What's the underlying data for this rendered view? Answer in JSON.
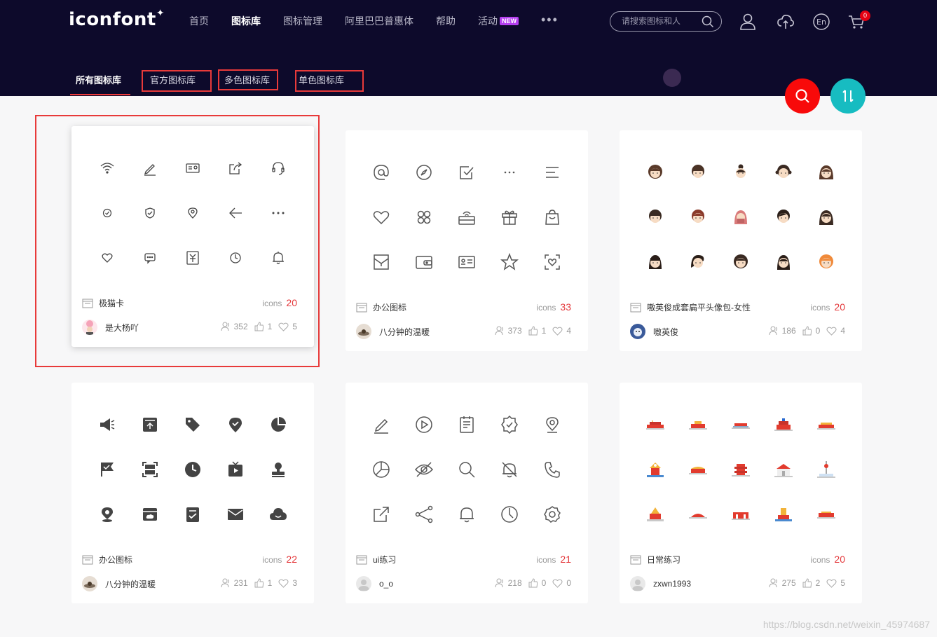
{
  "header": {
    "logo": "iconfont",
    "nav": [
      {
        "label": "首页"
      },
      {
        "label": "图标库",
        "active": true
      },
      {
        "label": "图标管理"
      },
      {
        "label": "阿里巴巴普惠体"
      },
      {
        "label": "帮助"
      },
      {
        "label": "活动",
        "badge": "NEW"
      },
      {
        "label": "•••"
      }
    ],
    "search_placeholder": "请搜索图标和人",
    "cart_count": "0"
  },
  "subnav": {
    "items": [
      "所有图标库",
      "官方图标库",
      "多色图标库",
      "单色图标库"
    ],
    "active": 0
  },
  "colors": {
    "header_bg": "#0d0a2b",
    "accent_red": "#e4393c",
    "fab_search": "#f80a0a",
    "fab_sort": "#17bcc1"
  },
  "cards": [
    {
      "title": "极猫卡",
      "count_label": "icons",
      "count": "20",
      "author": "是大杨吖",
      "views": "352",
      "likes": "1",
      "favs": "5"
    },
    {
      "title": "办公图标",
      "count_label": "icons",
      "count": "33",
      "author": "八分钟的温暖",
      "views": "373",
      "likes": "1",
      "favs": "4"
    },
    {
      "title": "嗷英俊成套扁平头像包-女性",
      "count_label": "icons",
      "count": "20",
      "author": "嗷英俊",
      "views": "186",
      "likes": "0",
      "favs": "4"
    },
    {
      "title": "办公图标",
      "count_label": "icons",
      "count": "22",
      "author": "八分钟的温暖",
      "views": "231",
      "likes": "1",
      "favs": "3"
    },
    {
      "title": "ui练习",
      "count_label": "icons",
      "count": "21",
      "author": "o_o",
      "views": "218",
      "likes": "0",
      "favs": "0"
    },
    {
      "title": "日常练习",
      "count_label": "icons",
      "count": "20",
      "author": "zxwn1993",
      "views": "275",
      "likes": "2",
      "favs": "5"
    }
  ],
  "watermark": "https://blog.csdn.net/weixin_45974687"
}
